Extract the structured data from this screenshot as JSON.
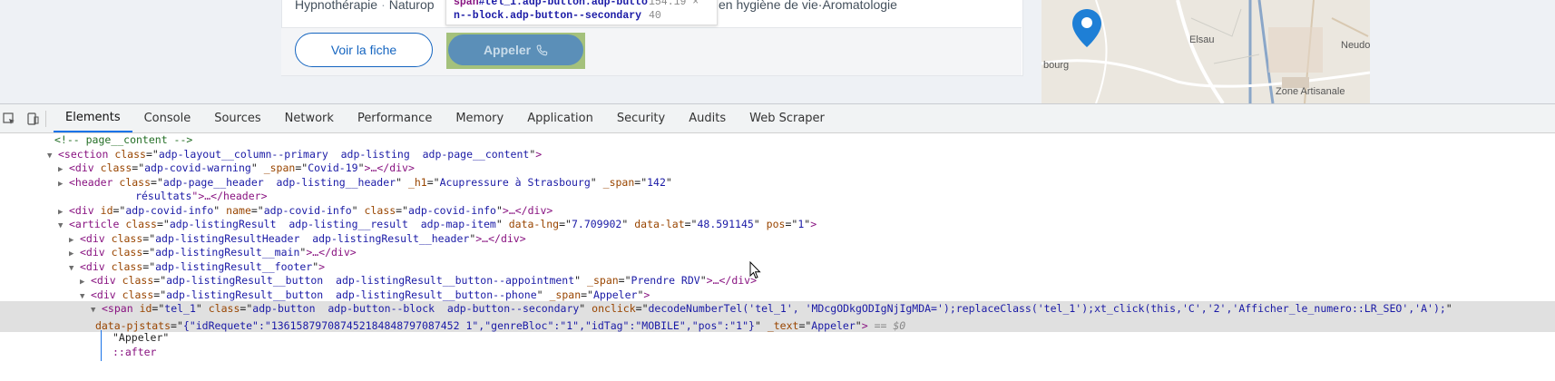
{
  "page": {
    "tags_left": [
      "Hypnothérapie",
      "Naturop"
    ],
    "tags_right": [
      "en hygiène de vie",
      "Aromatologie"
    ],
    "view_button": "Voir la fiche",
    "call_button": "Appeler",
    "tooltip": {
      "tag": "span",
      "selector_line1": "#tel_1.adp-button.adp-butto",
      "selector_line2": "n--block.adp-button--secondary",
      "dims": "154.19 × 40"
    },
    "map": {
      "labels": [
        "Elsau",
        "Neudo",
        "Zone Artisanale",
        "bourg"
      ],
      "pin_color": "#1e7fd6"
    }
  },
  "devtools": {
    "tabs": [
      "Elements",
      "Console",
      "Sources",
      "Network",
      "Performance",
      "Memory",
      "Application",
      "Security",
      "Audits",
      "Web Scraper"
    ],
    "active_tab": "Elements",
    "lines": [
      {
        "indent": 0,
        "kind": "comment",
        "text": "<!-- page__content -->"
      },
      {
        "indent": 0,
        "kind": "open",
        "twist": "▼",
        "tag": "section",
        "attrs": [
          [
            "class",
            "adp-layout__column--primary  adp-listing  adp-page__content"
          ]
        ],
        "tail": ">"
      },
      {
        "indent": 1,
        "kind": "open",
        "twist": "▶",
        "tag": "div",
        "attrs": [
          [
            "class",
            "adp-covid-warning"
          ],
          [
            "_span",
            "Covid-19"
          ]
        ],
        "tail": ">…</div>"
      },
      {
        "indent": 1,
        "kind": "open",
        "twist": "▶",
        "tag": "header",
        "attrs": [
          [
            "class",
            "adp-page__header  adp-listing__header"
          ],
          [
            "_h1",
            "Acupressure à Strasbourg"
          ],
          [
            "_span",
            "142"
          ]
        ],
        "tail": ""
      },
      {
        "indent": 1,
        "kind": "cont",
        "text": "            résultats",
        "tail": "\">…</header>"
      },
      {
        "indent": 1,
        "kind": "open",
        "twist": "▶",
        "tag": "div",
        "attrs": [
          [
            "id",
            "adp-covid-info"
          ],
          [
            "name",
            "adp-covid-info"
          ],
          [
            "class",
            "adp-covid-info"
          ]
        ],
        "tail": ">…</div>"
      },
      {
        "indent": 1,
        "kind": "open",
        "twist": "▼",
        "tag": "article",
        "attrs": [
          [
            "class",
            "adp-listingResult  adp-listing__result  adp-map-item"
          ],
          [
            "data-lng",
            "7.709902"
          ],
          [
            "data-lat",
            "48.591145"
          ],
          [
            "pos",
            "1"
          ]
        ],
        "tail": ">"
      },
      {
        "indent": 2,
        "kind": "open",
        "twist": "▶",
        "tag": "div",
        "attrs": [
          [
            "class",
            "adp-listingResultHeader  adp-listingResult__header"
          ]
        ],
        "tail": ">…</div>"
      },
      {
        "indent": 2,
        "kind": "open",
        "twist": "▶",
        "tag": "div",
        "attrs": [
          [
            "class",
            "adp-listingResult__main"
          ]
        ],
        "tail": ">…</div>"
      },
      {
        "indent": 2,
        "kind": "open",
        "twist": "▼",
        "tag": "div",
        "attrs": [
          [
            "class",
            "adp-listingResult__footer"
          ]
        ],
        "tail": ">"
      },
      {
        "indent": 3,
        "kind": "open",
        "twist": "▶",
        "tag": "div",
        "attrs": [
          [
            "class",
            "adp-listingResult__button  adp-listingResult__button--appointment"
          ],
          [
            "_span",
            "Prendre RDV"
          ]
        ],
        "tail": ">…</div>"
      },
      {
        "indent": 3,
        "kind": "open",
        "twist": "▼",
        "tag": "div",
        "attrs": [
          [
            "class",
            "adp-listingResult__button  adp-listingResult__button--phone"
          ],
          [
            "_span",
            "Appeler"
          ]
        ],
        "tail": ">"
      }
    ],
    "selected": {
      "line1_attrs": [
        [
          "id",
          "tel_1"
        ],
        [
          "class",
          "adp-button  adp-button--block  adp-button--secondary"
        ],
        [
          "onclick",
          "decodeNumberTel('tel_1', 'MDcgODkgODIgNjIgMDA=');replaceClass('tel_1');xt_click(this,'C','2','Afficher_le_numero::LR_SEO','A');"
        ]
      ],
      "line2_attrs": [
        [
          "data-pjstats",
          "{\"idRequete\":\"136158797087452184848797087452 1\",\"genreBloc\":\"1\",\"idTag\":\"MOBILE\",\"pos\":\"1\"}"
        ],
        [
          "_text",
          "Appeler"
        ]
      ],
      "eq": "== $0"
    },
    "child_text": "\"Appeler\"",
    "child_pseudo": "::after"
  }
}
